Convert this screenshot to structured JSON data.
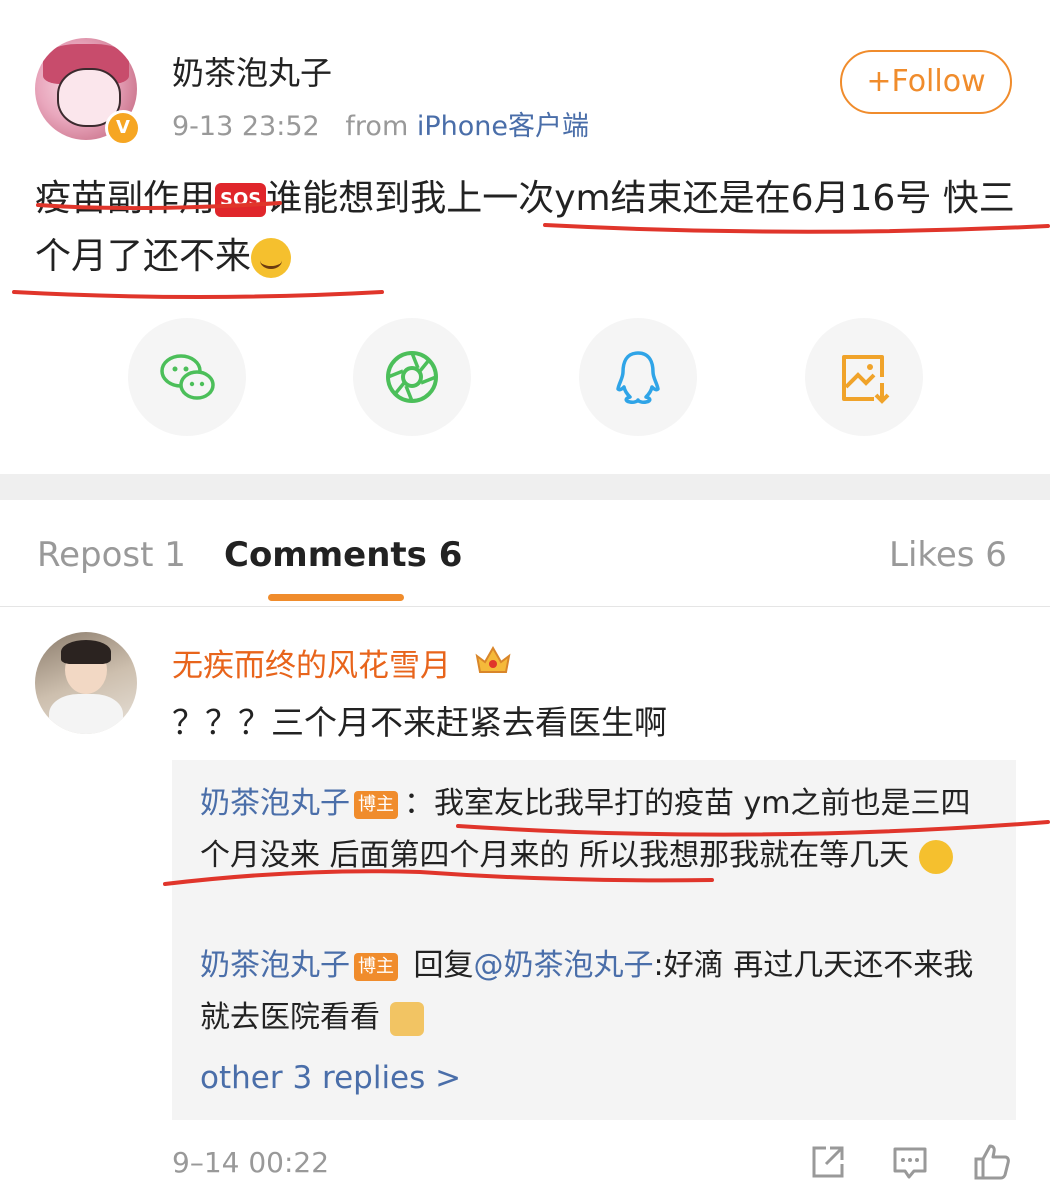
{
  "post": {
    "author": "奶茶泡丸子",
    "timestamp": "9-13 23:52",
    "from_label": "from",
    "source": "iPhone客户端",
    "verified_badge": "V",
    "follow_label": "+Follow",
    "text_part1": "疫苗副作用",
    "sos_emoji": "SOS",
    "text_part2": "谁能想到我上一次ym结束还是在6月16号 快三个月了还不来"
  },
  "share": {
    "items": [
      {
        "name": "wechat",
        "icon": "wechat-icon",
        "color": "#4cbf5a"
      },
      {
        "name": "moments",
        "icon": "moments-icon",
        "color": "#4cbf5a"
      },
      {
        "name": "qq",
        "icon": "qq-icon",
        "color": "#2fa4e7"
      },
      {
        "name": "save-image",
        "icon": "save-image-icon",
        "color": "#f0a32a"
      }
    ]
  },
  "tabs": {
    "repost": "Repost 1",
    "comments": "Comments 6",
    "likes": "Likes 6"
  },
  "comment": {
    "author": "无疾而终的风花雪月",
    "text": "？？？三个月不来赶紧去看医生啊",
    "timestamp": "9–14 00:22",
    "replies": [
      {
        "author": "奶茶泡丸子",
        "tag": "博主",
        "text": "：我室友比我早打的疫苗 ym之前也是三四个月没来 后面第四个月来的 所以我想那我就在等几天"
      },
      {
        "author": "奶茶泡丸子",
        "tag": "博主",
        "reply_word": "回复",
        "mention": "@奶茶泡丸子",
        "text": ":好滴 再过几天还不来我就去医院看看"
      }
    ],
    "more_replies": "other 3 replies >"
  },
  "colors": {
    "accent": "#f08c2c",
    "link": "#4a6ea9",
    "username_highlight": "#e8641b",
    "annotation_red": "#e0352b"
  }
}
